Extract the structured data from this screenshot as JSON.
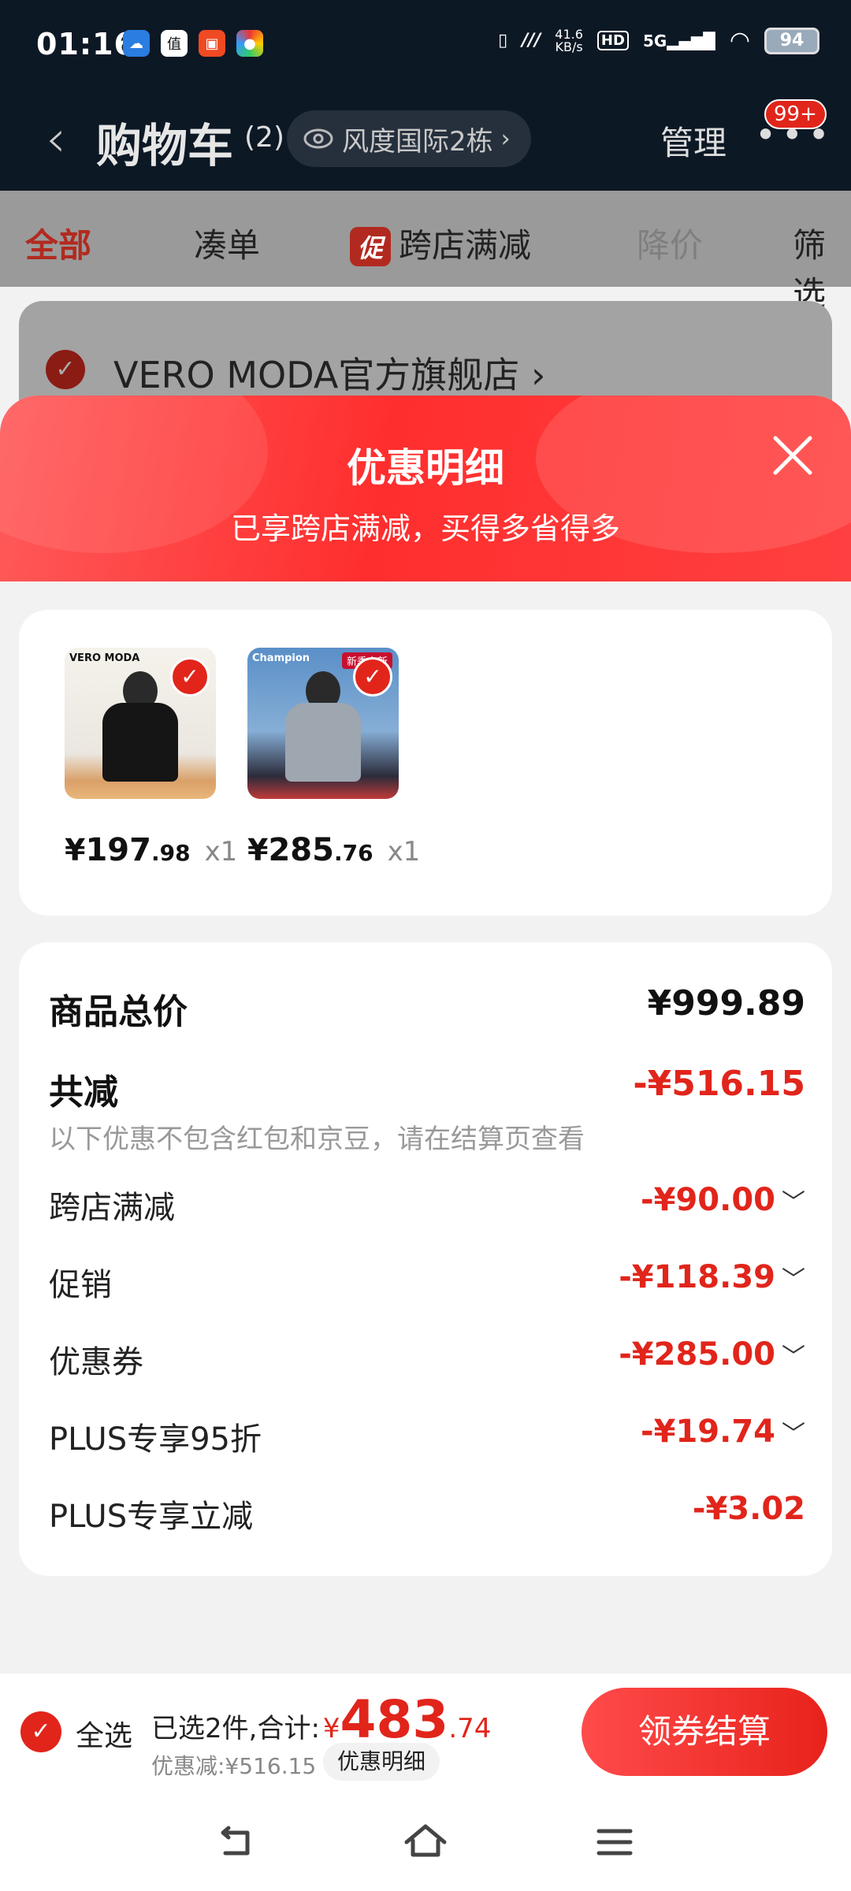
{
  "status_bar": {
    "time": "01:16",
    "net_speed": "41.6",
    "net_unit": "KB/s",
    "hd": "HD",
    "signal": "5G",
    "battery": "94"
  },
  "nav": {
    "title": "购物车",
    "count": "(2)",
    "address": "风度国际2栋",
    "manage": "管理",
    "badge": "99+"
  },
  "tabs": {
    "all": "全部",
    "bundle": "凑单",
    "promo_tag": "促",
    "cross_store": "跨店满减",
    "price_drop": "降价",
    "filter": "筛选"
  },
  "shop": {
    "name": "VERO MODA官方旗舰店",
    "arrow": "›"
  },
  "sheet": {
    "title": "优惠明细",
    "subtitle": "已享跨店满减，买得多省得多"
  },
  "items": [
    {
      "brand": "VERO MODA",
      "yuan": "¥",
      "price_int": "197",
      "price_dec": ".98",
      "qty": "x1"
    },
    {
      "brand": "Champion",
      "tag": "新季上新",
      "yuan": "¥",
      "price_int": "285",
      "price_dec": ".76",
      "qty": "x1"
    }
  ],
  "summary": {
    "total_label": "商品总价",
    "total_value": "¥999.89",
    "reduce_label": "共减",
    "reduce_value": "-¥516.15",
    "note": "以下优惠不包含红包和京豆，请在结算页查看",
    "rows": [
      {
        "label": "跨店满减",
        "value": "-¥90.00",
        "chevron": "﹀"
      },
      {
        "label": "促销",
        "value": "-¥118.39",
        "chevron": "﹀"
      },
      {
        "label": "优惠券",
        "value": "-¥285.00",
        "chevron": "﹀"
      },
      {
        "label": "PLUS专享95折",
        "value": "-¥19.74",
        "chevron": "﹀"
      },
      {
        "label": "PLUS专享立减",
        "value": "-¥3.02"
      }
    ]
  },
  "bottom": {
    "select_all": "全选",
    "selected_text": "已选2件,合计:",
    "yuan": "¥",
    "total_int": "483",
    "total_dec": ".74",
    "saved": "优惠减:¥516.15",
    "detail": "优惠明细",
    "checkout": "领券结算"
  },
  "colors": {
    "accent": "#e1251b",
    "header": "#ff3b3b",
    "nav_bg": "#0d1825"
  }
}
